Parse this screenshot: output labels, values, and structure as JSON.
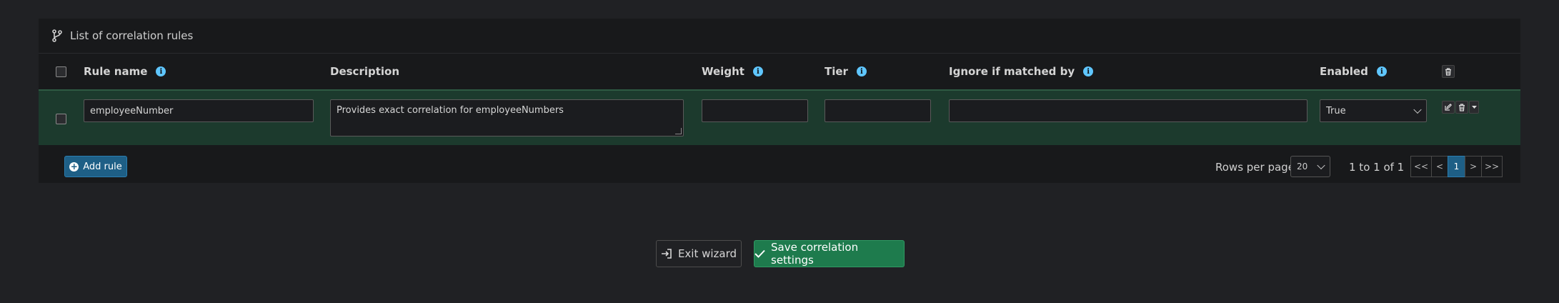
{
  "card": {
    "title": "List of correlation rules",
    "title_icon": "branch-icon"
  },
  "table": {
    "columns": [
      {
        "label": "Rule name",
        "info": true
      },
      {
        "label": "Description",
        "info": false
      },
      {
        "label": "Weight",
        "info": true
      },
      {
        "label": "Tier",
        "info": true
      },
      {
        "label": "Ignore if matched by",
        "info": true
      },
      {
        "label": "Enabled",
        "info": true
      }
    ],
    "info_glyph": "i",
    "rows": [
      {
        "rule_name": "employeeNumber",
        "description": "Provides exact correlation for employeeNumbers",
        "weight": "",
        "tier": "",
        "ignore_if_matched_by": "",
        "enabled": "True"
      }
    ]
  },
  "footer": {
    "add_rule_label": "Add rule",
    "add_rule_glyph": "+",
    "rows_per_page_label": "Rows per page",
    "rows_per_page_value": "20",
    "range_text": "1 to 1 of 1",
    "pager": {
      "first": "<<",
      "prev": "<",
      "current": "1",
      "next": ">",
      "last": ">>"
    }
  },
  "actions": {
    "exit_label": "Exit wizard",
    "save_label": "Save correlation settings"
  },
  "colors": {
    "row_highlight": "#1c3a2d",
    "primary": "#1e5f86",
    "success": "#1e7b4d",
    "info": "#5fc6ff"
  }
}
